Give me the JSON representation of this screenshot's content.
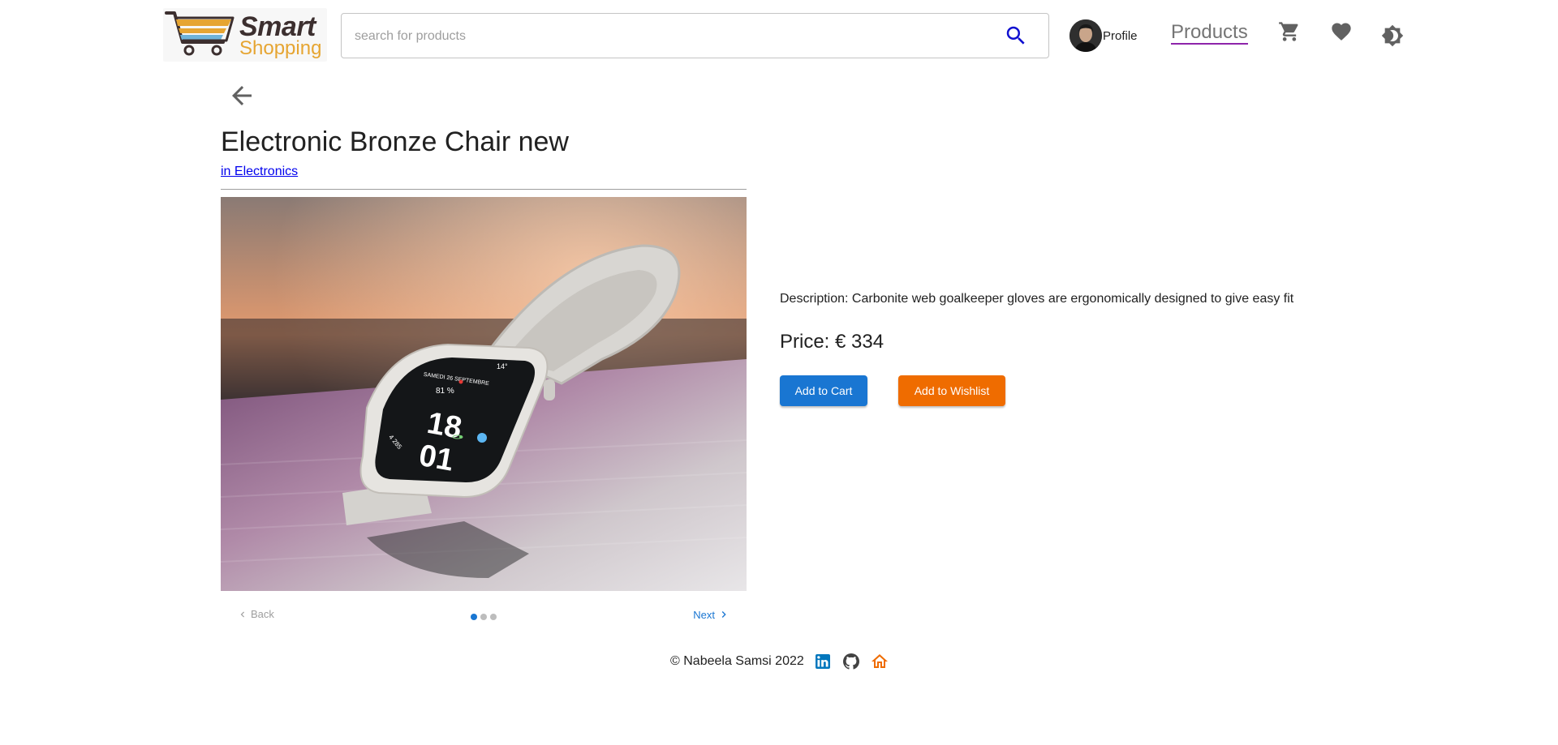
{
  "header": {
    "logo": {
      "line1": "Smart",
      "line2": "Shopping"
    },
    "search": {
      "placeholder": "search for products",
      "value": ""
    },
    "profile_label": "Profile",
    "nav_products": "Products",
    "icons": [
      "search-icon",
      "cart-icon",
      "heart-icon",
      "theme-toggle-icon"
    ]
  },
  "product": {
    "title": "Electronic Bronze Chair new",
    "category_link": "in Electronics",
    "description": "Description: Carbonite web goalkeeper gloves are ergonomically designed to give easy fit",
    "price": "Price: € 334",
    "add_to_cart": "Add to Cart",
    "add_to_wishlist": "Add to Wishlist",
    "image": {
      "watch_face": {
        "line1": "18",
        "line2": "01",
        "top_text": "SAMEDI 26 SEPTEMBRE",
        "battery": "81 %",
        "temp": "14°",
        "steps": "4 285"
      }
    }
  },
  "gallery": {
    "back_label": "Back",
    "next_label": "Next",
    "total_steps": 3,
    "active_step": 1
  },
  "footer": {
    "copyright": "© Nabeela Samsi 2022",
    "icons": [
      "linkedin-icon",
      "github-icon",
      "home-icon"
    ]
  },
  "colors": {
    "primary": "#1976d2",
    "wishlist": "#ef6c00",
    "nav_underline": "#8e24aa",
    "logo_brown": "#3c2f2f",
    "logo_orange": "#e6a532"
  }
}
